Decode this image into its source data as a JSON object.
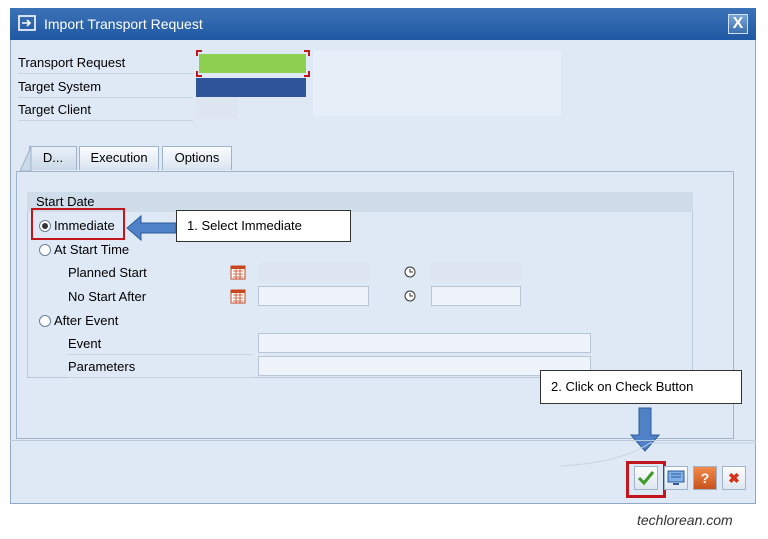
{
  "window": {
    "title": "Import Transport Request",
    "close_label": "X",
    "title_icon": "import-icon"
  },
  "header_fields": {
    "transport_request_label": "Transport Request",
    "target_system_label": "Target System",
    "target_client_label": "Target Client"
  },
  "tabs": [
    {
      "label": "D..."
    },
    {
      "label": "Execution"
    },
    {
      "label": "Options"
    }
  ],
  "start_date": {
    "group_title": "Start Date",
    "immediate_label": "Immediate",
    "at_start_time_label": "At Start Time",
    "planned_start_label": "Planned Start",
    "no_start_after_label": "No Start After",
    "after_event_label": "After Event",
    "event_label": "Event",
    "parameters_label": "Parameters",
    "selected_option": "Immediate"
  },
  "annotations": {
    "step1": "1. Select Immediate",
    "step2": "2. Click on Check Button"
  },
  "footer_buttons": [
    {
      "name": "check",
      "icon": "check-icon"
    },
    {
      "name": "transport-strategy",
      "icon": "monitor-icon"
    },
    {
      "name": "help",
      "icon": "help-icon",
      "glyph": "?"
    },
    {
      "name": "cancel",
      "icon": "cancel-icon",
      "glyph": "✖"
    }
  ],
  "colors": {
    "title_bar": "#2a64ad",
    "transport_request_fill": "#8ed04f",
    "target_system_fill": "#2f5598",
    "highlight_red": "#c0161c",
    "arrow_blue": "#4f81c7"
  },
  "watermark": "techlorean.com"
}
